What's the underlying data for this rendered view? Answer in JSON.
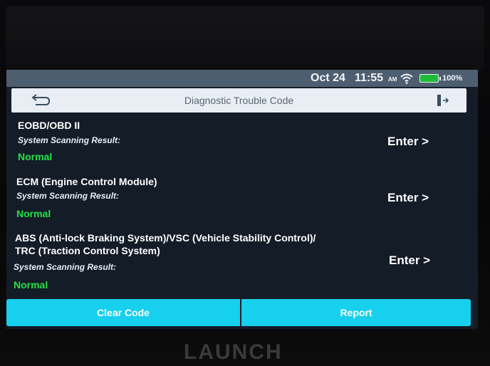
{
  "status_bar": {
    "date": "Oct 24",
    "time": "11:55",
    "ampm": "AM",
    "wifi_icon": "wifi-icon",
    "battery_icon": "battery-icon",
    "battery_percent": "100%"
  },
  "header": {
    "title": "Diagnostic Trouble Code",
    "back_icon": "back-arrow-icon",
    "exit_icon": "exit-icon"
  },
  "systems": [
    {
      "name": "EOBD/OBD II",
      "name_line2": "",
      "subtitle": "System Scanning Result:",
      "status": "Normal",
      "action": "Enter >"
    },
    {
      "name": "ECM (Engine Control Module)",
      "name_line2": "",
      "subtitle": "System Scanning Result:",
      "status": "Normal",
      "action": "Enter >"
    },
    {
      "name": "ABS (Anti-lock Braking System)/VSC (Vehicle Stability Control)/",
      "name_line2": "TRC (Traction Control System)",
      "subtitle": "System Scanning Result:",
      "status": "Normal",
      "action": "Enter >"
    }
  ],
  "buttons": {
    "clear_code": "Clear Code",
    "report": "Report"
  },
  "brand": "LAUNCH",
  "colors": {
    "screen_bg": "#141c27",
    "status_green": "#27e04a",
    "button_cyan": "#16d0ee",
    "title_bar": "#e8eef4"
  }
}
